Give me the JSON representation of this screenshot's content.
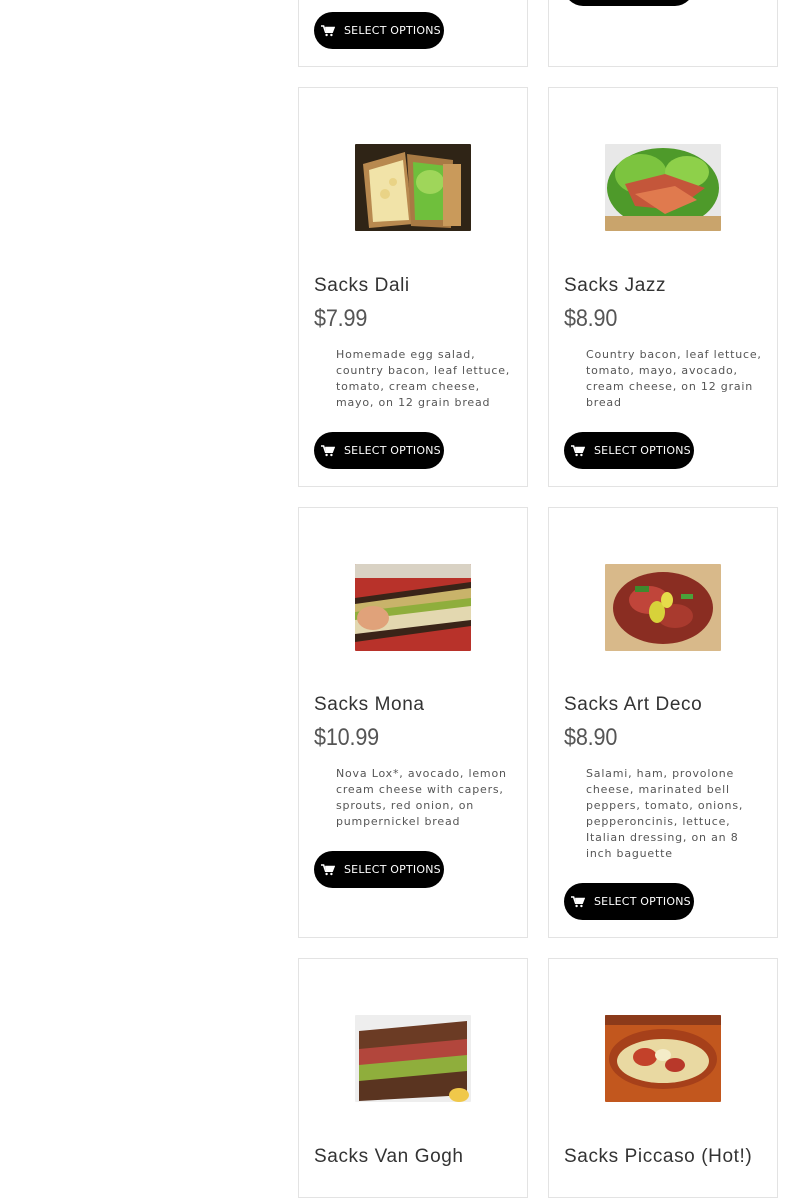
{
  "button_label": "SELECT OPTIONS",
  "products": [
    {
      "name": "Sacks Dali",
      "price": "$7.99",
      "description": "Homemade egg salad, country bacon, leaf lettuce, tomato, cream cheese, mayo, on 12 grain bread",
      "image": "egg-salad-sandwich"
    },
    {
      "name": "Sacks Jazz",
      "price": "$8.90",
      "description": "Country bacon, leaf lettuce, tomato, mayo, avocado, cream cheese, on 12 grain bread",
      "image": "bacon-lettuce-sandwich"
    },
    {
      "name": "Sacks Mona",
      "price": "$10.99",
      "description": "Nova Lox*, avocado, lemon cream cheese with capers, sprouts, red onion, on pumpernickel bread",
      "image": "lox-sprouts-sandwich"
    },
    {
      "name": "Sacks Art Deco",
      "price": "$8.90",
      "description": "Salami, ham, provolone cheese, marinated bell peppers, tomato, onions, pepperoncinis, lettuce, Italian dressing, on an 8 inch baguette",
      "image": "italian-baguette-sandwich"
    },
    {
      "name": "Sacks Van Gogh",
      "image": "pastrami-sprouts-sandwich"
    },
    {
      "name": "Sacks Piccaso (Hot!)",
      "image": "hot-cheese-sub"
    }
  ]
}
